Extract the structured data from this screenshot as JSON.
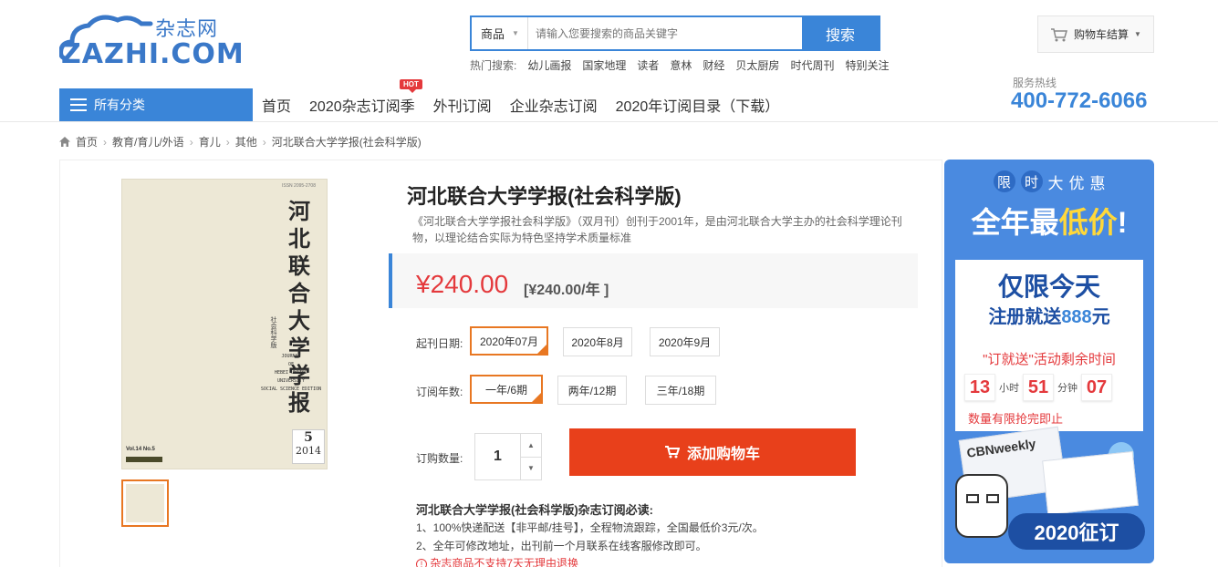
{
  "logo": {
    "zh": "杂志网",
    "en": "ZAZHI.COM"
  },
  "search": {
    "category": "商品",
    "placeholder": "请输入您要搜索的商品关键字",
    "button": "搜索",
    "hot_label": "热门搜索:",
    "hot_terms": [
      "幼儿画报",
      "国家地理",
      "读者",
      "意林",
      "财经",
      "贝太厨房",
      "时代周刊",
      "特别关注"
    ]
  },
  "cart": {
    "label": "购物车结算"
  },
  "nav": {
    "all_categories": "所有分类",
    "links": [
      "首页",
      "2020杂志订阅季",
      "外刊订阅",
      "企业杂志订阅",
      "2020年订阅目录（下载）"
    ],
    "hot_badge": "HOT",
    "hotline_label": "服务热线",
    "phone": "400-772-6066"
  },
  "breadcrumb": [
    "首页",
    "教育/育儿/外语",
    "育儿",
    "其他",
    "河北联合大学学报(社会科学版)"
  ],
  "product": {
    "title": "河北联合大学学报(社会科学版)",
    "description": "《河北联合大学学报社会科学版》（双月刊）创刊于2001年，是由河北联合大学主办的社会科学理论刊物，以理论结合实际为特色坚持学术质量标准",
    "price": "¥240.00",
    "per_year": "[¥240.00/年 ]",
    "start_label": "起刊日期:",
    "start_options": [
      "2020年07月",
      "2020年8月",
      "2020年9月"
    ],
    "start_selected": 0,
    "years_label": "订阅年数:",
    "year_options": [
      "一年/6期",
      "两年/12期",
      "三年/18期"
    ],
    "year_selected": 0,
    "qty_label": "订购数量:",
    "qty": "1",
    "add_to_cart": "添加购物车",
    "must_read_title": "河北联合大学学报(社会科学版)杂志订阅必读:",
    "rule1": "1、100%快递配送【非平邮/挂号】，全程物流跟踪，全国最低价3元/次。",
    "rule2": "2、全年可修改地址，出刊前一个月联系在线客服修改即可。",
    "warning": "杂志商品不支持7天无理由退换",
    "cover": {
      "title_vertical": "河北联合大学学报",
      "subtitle": "社会科学版",
      "en1": "JOURNAL",
      "en2": "OF",
      "en3": "HEBEI UNITED",
      "en4": "UNIVERSITY",
      "en5": "SOCIAL SCIENCE EDITION",
      "issue": "5",
      "year": "2014",
      "vol": "Vol.14 No.5",
      "issn": "ISSN 2095-2708"
    }
  },
  "promo": {
    "top_chars": [
      "限",
      "时",
      "大",
      "优",
      "惠"
    ],
    "headline_a": "全年最",
    "headline_b": "低价",
    "headline_c": "!",
    "today": "仅限今天",
    "register_a": "注册就送",
    "register_n": "888",
    "register_b": "元",
    "activity": "\"订就送\"活动剩余时间",
    "hours": "13",
    "hours_label": "小时",
    "minutes": "51",
    "minutes_label": "分钟",
    "seconds": "07",
    "limited": "数量有限抢完即止",
    "magazine": "CBNweekly",
    "order": "2020征订"
  }
}
